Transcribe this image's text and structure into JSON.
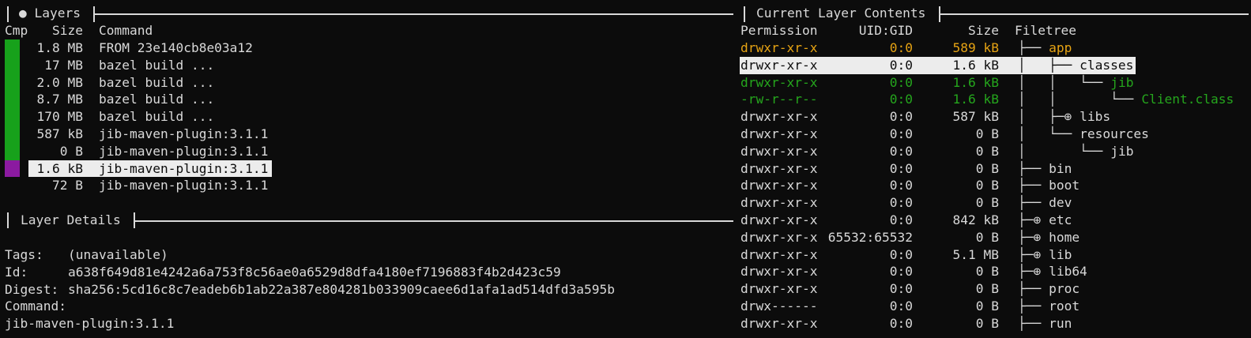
{
  "colors": {
    "bar_green": "#17a11b",
    "bar_purple": "#8b1aa0",
    "added": "#25a61d",
    "modified": "#e6a313",
    "normal": "#d9d9d9",
    "highlight_bg": "#ececec"
  },
  "layers_pane": {
    "title": "● Layers",
    "columns": {
      "cmp": "Cmp",
      "size": "Size",
      "command": "Command"
    },
    "rows": [
      {
        "size": "1.8 MB",
        "command": "FROM 23e140cb8e03a12",
        "bar": "green"
      },
      {
        "size": "17 MB",
        "command": "bazel build ...",
        "bar": "green"
      },
      {
        "size": "2.0 MB",
        "command": "bazel build ...",
        "bar": "green"
      },
      {
        "size": "8.7 MB",
        "command": "bazel build ...",
        "bar": "green"
      },
      {
        "size": "170 MB",
        "command": "bazel build ...",
        "bar": "green"
      },
      {
        "size": "587 kB",
        "command": "jib-maven-plugin:3.1.1",
        "bar": "green"
      },
      {
        "size": "0 B",
        "command": "jib-maven-plugin:3.1.1",
        "bar": "green"
      },
      {
        "size": "1.6 kB",
        "command": "jib-maven-plugin:3.1.1",
        "bar": "purple",
        "selected": true
      },
      {
        "size": "72 B",
        "command": "jib-maven-plugin:3.1.1",
        "bar": "none"
      }
    ]
  },
  "details_pane": {
    "title": "Layer Details",
    "tags_label": "Tags:",
    "tags_value": "(unavailable)",
    "id_label": "Id:",
    "id_value": "a638f649d81e4242a6a753f8c56ae0a6529d8dfa4180ef7196883f4b2d423c59",
    "digest_label": "Digest:",
    "digest_value": "sha256:5cd16c8c7eadeb6b1ab22a387e804281b033909caee6d1afa1ad514dfd3a595b",
    "command_label": "Command:",
    "command_value": "jib-maven-plugin:3.1.1"
  },
  "contents_pane": {
    "title": "Current Layer Contents",
    "columns": {
      "permission": "Permission",
      "uidgid": "UID:GID",
      "size": "Size",
      "filetree": "Filetree"
    },
    "rows": [
      {
        "perm": "drwxr-xr-x",
        "uid": "0:0",
        "size": "589 kB",
        "tree": "├── ",
        "name": "app",
        "color": "modified"
      },
      {
        "perm": "drwxr-xr-x",
        "uid": "0:0",
        "size": "1.6 kB",
        "tree": "│   ├── ",
        "name": "classes",
        "color": "normal",
        "selected": true
      },
      {
        "perm": "drwxr-xr-x",
        "uid": "0:0",
        "size": "1.6 kB",
        "tree": "│   │   └── ",
        "name": "jib",
        "color": "added"
      },
      {
        "perm": "-rw-r--r--",
        "uid": "0:0",
        "size": "1.6 kB",
        "tree": "│   │       └── ",
        "name": "Client.class",
        "color": "added"
      },
      {
        "perm": "drwxr-xr-x",
        "uid": "0:0",
        "size": "587 kB",
        "tree": "│   ├─⊕ ",
        "name": "libs",
        "color": "normal"
      },
      {
        "perm": "drwxr-xr-x",
        "uid": "0:0",
        "size": "0 B",
        "tree": "│   └── ",
        "name": "resources",
        "color": "normal"
      },
      {
        "perm": "drwxr-xr-x",
        "uid": "0:0",
        "size": "0 B",
        "tree": "│       └── ",
        "name": "jib",
        "color": "normal"
      },
      {
        "perm": "drwxr-xr-x",
        "uid": "0:0",
        "size": "0 B",
        "tree": "├── ",
        "name": "bin",
        "color": "normal"
      },
      {
        "perm": "drwxr-xr-x",
        "uid": "0:0",
        "size": "0 B",
        "tree": "├── ",
        "name": "boot",
        "color": "normal"
      },
      {
        "perm": "drwxr-xr-x",
        "uid": "0:0",
        "size": "0 B",
        "tree": "├── ",
        "name": "dev",
        "color": "normal"
      },
      {
        "perm": "drwxr-xr-x",
        "uid": "0:0",
        "size": "842 kB",
        "tree": "├─⊕ ",
        "name": "etc",
        "color": "normal"
      },
      {
        "perm": "drwxr-xr-x",
        "uid": "65532:65532",
        "size": "0 B",
        "tree": "├─⊕ ",
        "name": "home",
        "color": "normal"
      },
      {
        "perm": "drwxr-xr-x",
        "uid": "0:0",
        "size": "5.1 MB",
        "tree": "├─⊕ ",
        "name": "lib",
        "color": "normal"
      },
      {
        "perm": "drwxr-xr-x",
        "uid": "0:0",
        "size": "0 B",
        "tree": "├─⊕ ",
        "name": "lib64",
        "color": "normal"
      },
      {
        "perm": "drwxr-xr-x",
        "uid": "0:0",
        "size": "0 B",
        "tree": "├── ",
        "name": "proc",
        "color": "normal"
      },
      {
        "perm": "drwx------",
        "uid": "0:0",
        "size": "0 B",
        "tree": "├── ",
        "name": "root",
        "color": "normal"
      },
      {
        "perm": "drwxr-xr-x",
        "uid": "0:0",
        "size": "0 B",
        "tree": "├── ",
        "name": "run",
        "color": "normal"
      }
    ]
  }
}
